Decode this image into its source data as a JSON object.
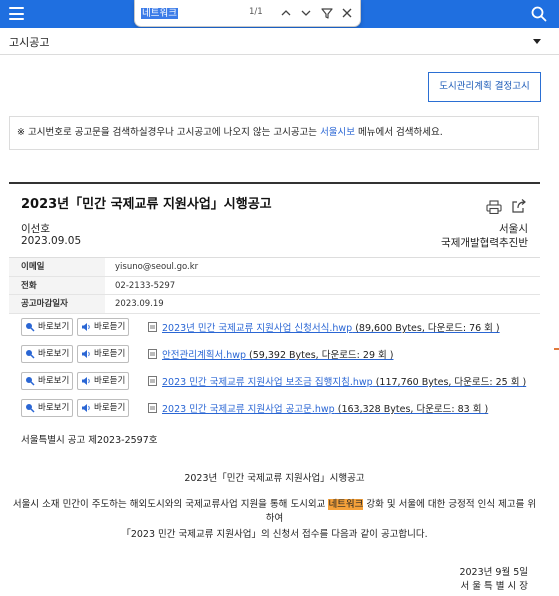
{
  "find": {
    "query": "네트워크",
    "count": "1/1"
  },
  "category": {
    "label": "고시공고"
  },
  "plan_button": "도시관리계획 결정고시",
  "notice": {
    "prefix": "※ 고시번호로 공고문을 검색하실경우나 고시공고에 나오지 않는 고시공고는 ",
    "link": "서울시보",
    "suffix": " 메뉴에서 검색하세요."
  },
  "article": {
    "title": "2023년「민간 국제교류 지원사업」시행공고",
    "author": "이선호",
    "date": "2023.09.05",
    "org1": "서울시",
    "org2": "국제개발협력추진반",
    "info": [
      {
        "key": "이메일",
        "value": "yisuno@seoul.go.kr"
      },
      {
        "key": "전화",
        "value": "02-2133-5297"
      },
      {
        "key": "공고마감일자",
        "value": "2023.09.19"
      }
    ],
    "view_label": "바로보기",
    "listen_label": "바로듣기",
    "files": [
      {
        "name": "2023년 민간 국제교류 지원사업 신청서식.hwp",
        "meta": " (89,600 Bytes, 다운로드: 76 회 )"
      },
      {
        "name": "안전관리계획서.hwp",
        "meta": " (59,392 Bytes, 다운로드: 29 회 )"
      },
      {
        "name": "2023 민간 국제교류 지원사업 보조금 집행지침.hwp",
        "meta": " (117,760 Bytes, 다운로드: 25 회 )"
      },
      {
        "name": "2023 민간 국제교류 지원사업 공고문.hwp",
        "meta": " (163,328 Bytes, 다운로드: 83 회 )"
      }
    ],
    "doc_number": "서울특별시 공고 제2023-2597호",
    "body_title": "2023년「민간 국제교류 지원사업」시행공고",
    "body_para_before": "서울시 소재 민간이 주도하는 해외도시와의 국제교류사업 지원을 통해 도시외교 ",
    "body_para_highlight": "네트워크",
    "body_para_after": " 강화 및 서울에 대한 긍정적 인식 제고를 위하여",
    "body_line2": "「2023 민간 국제교류 지원사업」의 신청서 접수를 다음과 같이 공고합니다.",
    "sign_date": "2023년 9월 5일",
    "sign_org": "서 울 특 별 시 장"
  },
  "colors": {
    "topbar": "#1f6fe0",
    "link": "#2a66d4",
    "highlight": "#f5a13a"
  }
}
